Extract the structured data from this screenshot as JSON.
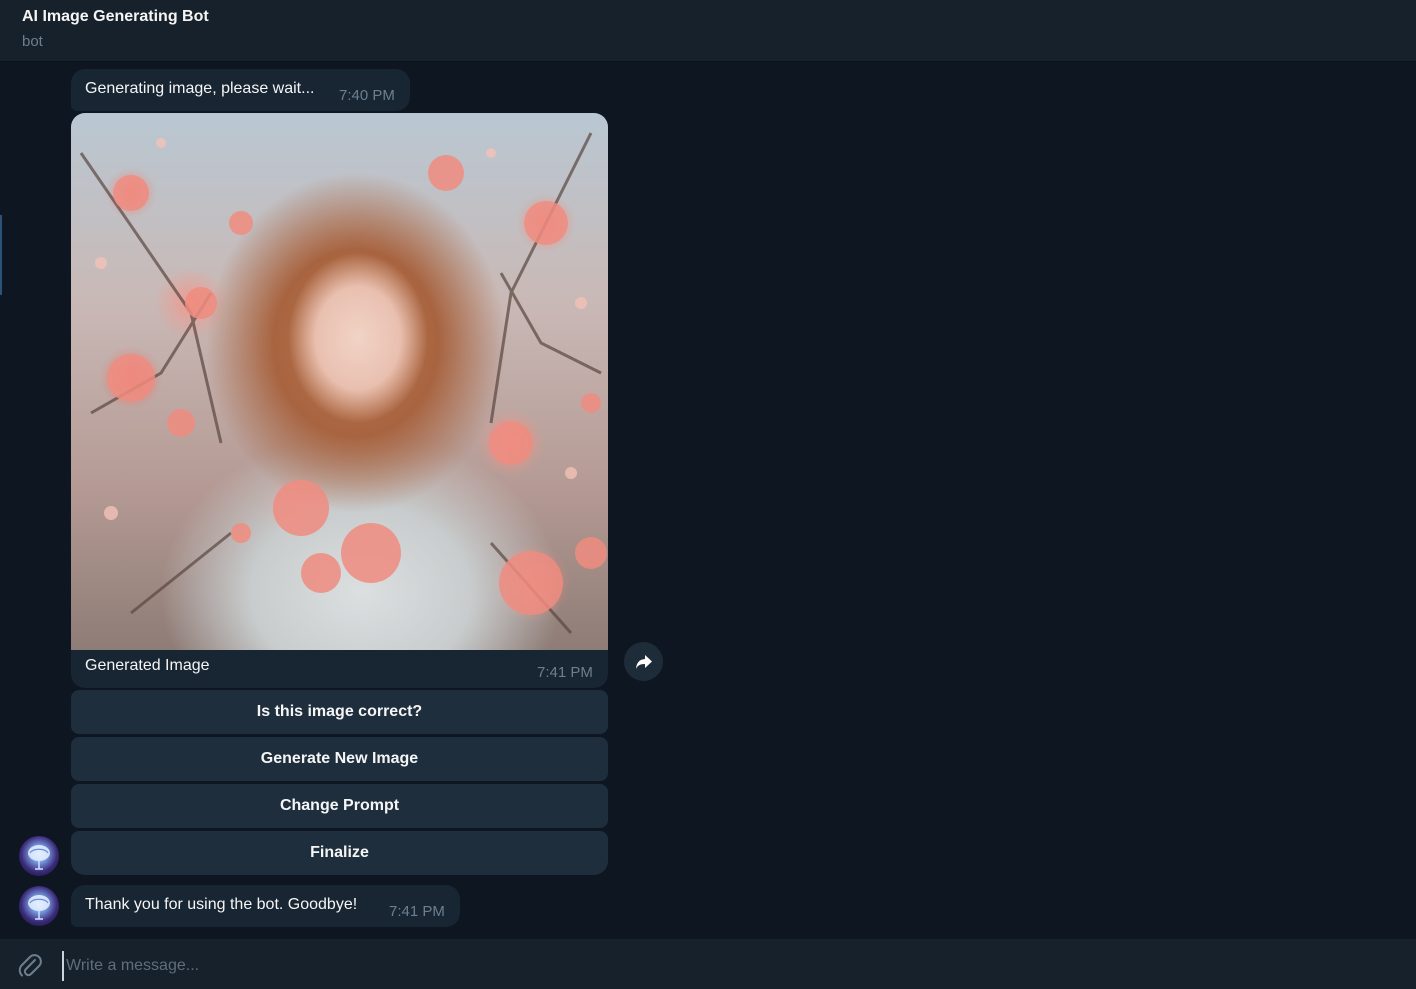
{
  "header": {
    "title": "AI Image Generating Bot",
    "subtitle": "bot"
  },
  "messages": {
    "generating": {
      "text": "Generating image, please wait...",
      "time": "7:40 PM"
    },
    "image": {
      "caption": "Generated Image",
      "time": "7:41 PM",
      "alt": "Painted portrait of a girl among pink blossoms"
    },
    "goodbye": {
      "text": "Thank you for using the bot. Goodbye!",
      "time": "7:41 PM"
    }
  },
  "keyboard": {
    "buttons": [
      "Is this image correct?",
      "Generate New Image",
      "Change Prompt",
      "Finalize"
    ]
  },
  "composer": {
    "placeholder": "Write a message..."
  },
  "colors": {
    "background": "#0e1621",
    "header": "#17212b",
    "bubble": "#182533",
    "button": "#1f2e3d",
    "muted": "#6d7f8f"
  }
}
